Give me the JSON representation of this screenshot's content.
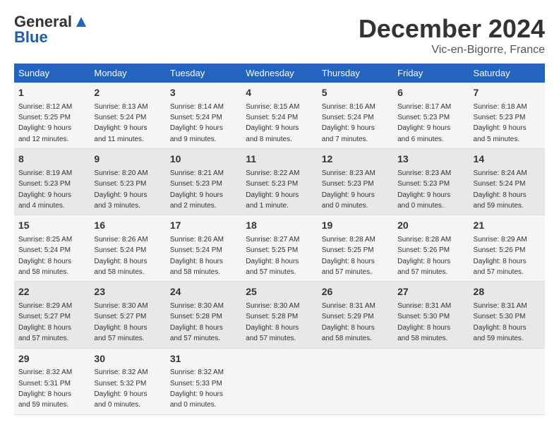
{
  "header": {
    "logo_general": "General",
    "logo_blue": "Blue",
    "month": "December 2024",
    "location": "Vic-en-Bigorre, France"
  },
  "weekdays": [
    "Sunday",
    "Monday",
    "Tuesday",
    "Wednesday",
    "Thursday",
    "Friday",
    "Saturday"
  ],
  "weeks": [
    [
      {
        "day": "1",
        "info": "Sunrise: 8:12 AM\nSunset: 5:25 PM\nDaylight: 9 hours\nand 12 minutes."
      },
      {
        "day": "2",
        "info": "Sunrise: 8:13 AM\nSunset: 5:24 PM\nDaylight: 9 hours\nand 11 minutes."
      },
      {
        "day": "3",
        "info": "Sunrise: 8:14 AM\nSunset: 5:24 PM\nDaylight: 9 hours\nand 9 minutes."
      },
      {
        "day": "4",
        "info": "Sunrise: 8:15 AM\nSunset: 5:24 PM\nDaylight: 9 hours\nand 8 minutes."
      },
      {
        "day": "5",
        "info": "Sunrise: 8:16 AM\nSunset: 5:24 PM\nDaylight: 9 hours\nand 7 minutes."
      },
      {
        "day": "6",
        "info": "Sunrise: 8:17 AM\nSunset: 5:23 PM\nDaylight: 9 hours\nand 6 minutes."
      },
      {
        "day": "7",
        "info": "Sunrise: 8:18 AM\nSunset: 5:23 PM\nDaylight: 9 hours\nand 5 minutes."
      }
    ],
    [
      {
        "day": "8",
        "info": "Sunrise: 8:19 AM\nSunset: 5:23 PM\nDaylight: 9 hours\nand 4 minutes."
      },
      {
        "day": "9",
        "info": "Sunrise: 8:20 AM\nSunset: 5:23 PM\nDaylight: 9 hours\nand 3 minutes."
      },
      {
        "day": "10",
        "info": "Sunrise: 8:21 AM\nSunset: 5:23 PM\nDaylight: 9 hours\nand 2 minutes."
      },
      {
        "day": "11",
        "info": "Sunrise: 8:22 AM\nSunset: 5:23 PM\nDaylight: 9 hours\nand 1 minute."
      },
      {
        "day": "12",
        "info": "Sunrise: 8:23 AM\nSunset: 5:23 PM\nDaylight: 9 hours\nand 0 minutes."
      },
      {
        "day": "13",
        "info": "Sunrise: 8:23 AM\nSunset: 5:23 PM\nDaylight: 9 hours\nand 0 minutes."
      },
      {
        "day": "14",
        "info": "Sunrise: 8:24 AM\nSunset: 5:24 PM\nDaylight: 8 hours\nand 59 minutes."
      }
    ],
    [
      {
        "day": "15",
        "info": "Sunrise: 8:25 AM\nSunset: 5:24 PM\nDaylight: 8 hours\nand 58 minutes."
      },
      {
        "day": "16",
        "info": "Sunrise: 8:26 AM\nSunset: 5:24 PM\nDaylight: 8 hours\nand 58 minutes."
      },
      {
        "day": "17",
        "info": "Sunrise: 8:26 AM\nSunset: 5:24 PM\nDaylight: 8 hours\nand 58 minutes."
      },
      {
        "day": "18",
        "info": "Sunrise: 8:27 AM\nSunset: 5:25 PM\nDaylight: 8 hours\nand 57 minutes."
      },
      {
        "day": "19",
        "info": "Sunrise: 8:28 AM\nSunset: 5:25 PM\nDaylight: 8 hours\nand 57 minutes."
      },
      {
        "day": "20",
        "info": "Sunrise: 8:28 AM\nSunset: 5:26 PM\nDaylight: 8 hours\nand 57 minutes."
      },
      {
        "day": "21",
        "info": "Sunrise: 8:29 AM\nSunset: 5:26 PM\nDaylight: 8 hours\nand 57 minutes."
      }
    ],
    [
      {
        "day": "22",
        "info": "Sunrise: 8:29 AM\nSunset: 5:27 PM\nDaylight: 8 hours\nand 57 minutes."
      },
      {
        "day": "23",
        "info": "Sunrise: 8:30 AM\nSunset: 5:27 PM\nDaylight: 8 hours\nand 57 minutes."
      },
      {
        "day": "24",
        "info": "Sunrise: 8:30 AM\nSunset: 5:28 PM\nDaylight: 8 hours\nand 57 minutes."
      },
      {
        "day": "25",
        "info": "Sunrise: 8:30 AM\nSunset: 5:28 PM\nDaylight: 8 hours\nand 57 minutes."
      },
      {
        "day": "26",
        "info": "Sunrise: 8:31 AM\nSunset: 5:29 PM\nDaylight: 8 hours\nand 58 minutes."
      },
      {
        "day": "27",
        "info": "Sunrise: 8:31 AM\nSunset: 5:30 PM\nDaylight: 8 hours\nand 58 minutes."
      },
      {
        "day": "28",
        "info": "Sunrise: 8:31 AM\nSunset: 5:30 PM\nDaylight: 8 hours\nand 59 minutes."
      }
    ],
    [
      {
        "day": "29",
        "info": "Sunrise: 8:32 AM\nSunset: 5:31 PM\nDaylight: 8 hours\nand 59 minutes."
      },
      {
        "day": "30",
        "info": "Sunrise: 8:32 AM\nSunset: 5:32 PM\nDaylight: 9 hours\nand 0 minutes."
      },
      {
        "day": "31",
        "info": "Sunrise: 8:32 AM\nSunset: 5:33 PM\nDaylight: 9 hours\nand 0 minutes."
      },
      {
        "day": "",
        "info": ""
      },
      {
        "day": "",
        "info": ""
      },
      {
        "day": "",
        "info": ""
      },
      {
        "day": "",
        "info": ""
      }
    ]
  ]
}
